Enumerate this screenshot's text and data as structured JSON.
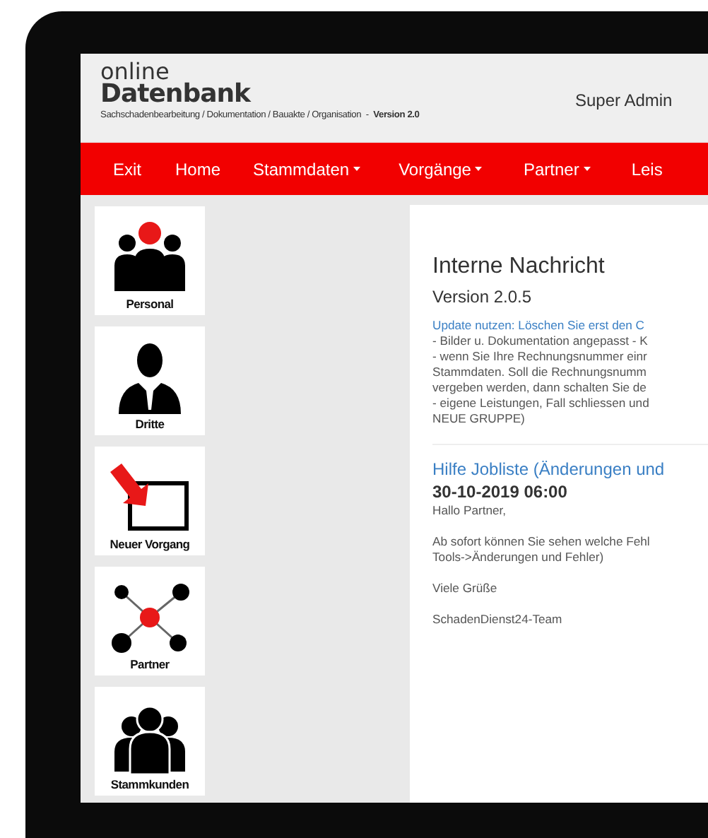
{
  "header": {
    "logo_top": "online",
    "logo_main": "Datenbank",
    "subtitle": "Sachschadenbearbeitung / Dokumentation / Bauakte / Organisation  -  **Version 2.0**",
    "user": "Super Admin"
  },
  "nav": [
    {
      "label": "Exit",
      "has_menu": false
    },
    {
      "label": "Home",
      "has_menu": false
    },
    {
      "label": "Stammdaten",
      "has_menu": true
    },
    {
      "label": "Vorgänge",
      "has_menu": true
    },
    {
      "label": "Partner",
      "has_menu": true
    },
    {
      "label": "Leis",
      "has_menu": false
    }
  ],
  "sidebar": [
    {
      "kind": "group",
      "label": "Personal"
    },
    {
      "kind": "person",
      "label": "Dritte"
    },
    {
      "kind": "new",
      "label": "Neuer Vorgang"
    },
    {
      "kind": "network",
      "label": "Partner"
    },
    {
      "kind": "crowd",
      "label": "Stammkunden"
    }
  ],
  "message": {
    "title": "Interne Nachricht",
    "version": "Version 2.0.5",
    "link": "Update nutzen: Löschen Sie erst den C",
    "lines": [
      "- Bilder u. Dokumentation angepasst - K",
      "- wenn Sie Ihre Rechnungsnummer einr",
      "Stammdaten. Soll die Rechnungsnumm",
      "vergeben werden, dann schalten Sie de",
      "- eigene Leistungen, Fall schliessen und",
      "NEUE GRUPPE)"
    ]
  },
  "post": {
    "title": "Hilfe Jobliste (Änderungen und",
    "date": "30-10-2019 06:00",
    "paragraphs": [
      [
        "Hallo Partner,"
      ],
      [
        "Ab sofort können Sie sehen welche Fehl",
        "Tools->Änderungen und Fehler)"
      ],
      [
        "Viele Grüße"
      ],
      [
        "SchadenDienst24-Team"
      ]
    ]
  }
}
